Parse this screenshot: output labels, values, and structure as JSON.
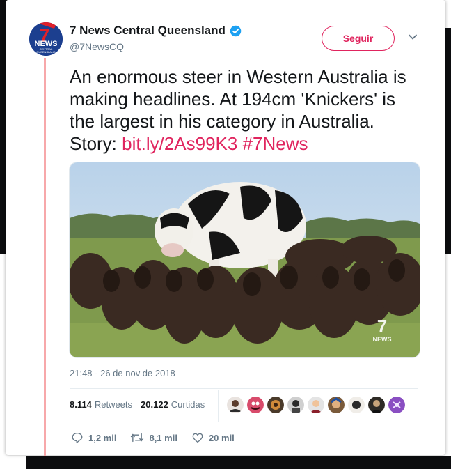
{
  "account": {
    "name": "7 News Central Queensland",
    "handle": "@7NewsCQ",
    "logo": {
      "big": "7",
      "word": "NEWS",
      "sub1": "CENTRAL",
      "sub2": "QUEENSLAND"
    }
  },
  "follow_button": {
    "label": "Seguir"
  },
  "tweet": {
    "text": "An enormous steer in Western Australia is making headlines. At 194cm 'Knickers' is the largest in his category in Australia. Story: ",
    "link": "bit.ly/2As99K3",
    "hashtag": "#7News"
  },
  "media": {
    "watermark_big": "7",
    "watermark_word": "NEWS"
  },
  "timestamp": "21:48 - 26 de nov de 2018",
  "stats": {
    "retweets_count": "8.114",
    "retweets_label": "Retweets",
    "likes_count": "20.122",
    "likes_label": "Curtidas"
  },
  "actions": {
    "replies": "1,2 mil",
    "retweets": "8,1 mil",
    "likes": "20 mil"
  },
  "icons": [
    "verified-badge-icon",
    "chevron-down-icon",
    "reply-icon",
    "retweet-icon",
    "heart-icon"
  ],
  "colors": {
    "accent": "#e0245e",
    "verified": "#1da1f2",
    "muted": "#657786",
    "thread": "#f7a8aa"
  }
}
